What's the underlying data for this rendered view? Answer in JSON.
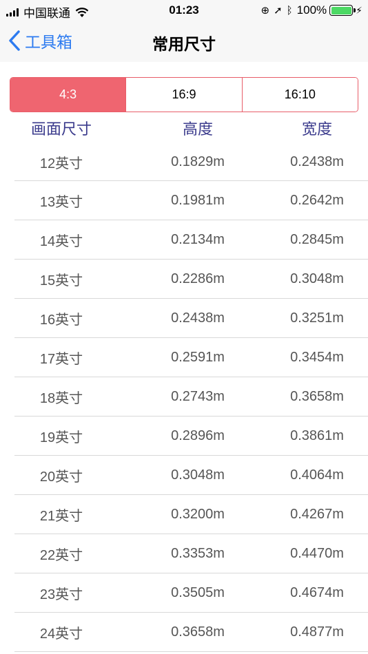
{
  "status": {
    "carrier": "中国联通",
    "time": "01:23",
    "battery_pct": "100%"
  },
  "nav": {
    "back_label": "工具箱",
    "title": "常用尺寸"
  },
  "tabs": [
    {
      "label": "4:3",
      "active": true
    },
    {
      "label": "16:9",
      "active": false
    },
    {
      "label": "16:10",
      "active": false
    }
  ],
  "columns": {
    "size": "画面尺寸",
    "height": "高度",
    "width": "宽度"
  },
  "rows": [
    {
      "size": "12英寸",
      "height": "0.1829m",
      "width": "0.2438m"
    },
    {
      "size": "13英寸",
      "height": "0.1981m",
      "width": "0.2642m"
    },
    {
      "size": "14英寸",
      "height": "0.2134m",
      "width": "0.2845m"
    },
    {
      "size": "15英寸",
      "height": "0.2286m",
      "width": "0.3048m"
    },
    {
      "size": "16英寸",
      "height": "0.2438m",
      "width": "0.3251m"
    },
    {
      "size": "17英寸",
      "height": "0.2591m",
      "width": "0.3454m"
    },
    {
      "size": "18英寸",
      "height": "0.2743m",
      "width": "0.3658m"
    },
    {
      "size": "19英寸",
      "height": "0.2896m",
      "width": "0.3861m"
    },
    {
      "size": "20英寸",
      "height": "0.3048m",
      "width": "0.4064m"
    },
    {
      "size": "21英寸",
      "height": "0.3200m",
      "width": "0.4267m"
    },
    {
      "size": "22英寸",
      "height": "0.3353m",
      "width": "0.4470m"
    },
    {
      "size": "23英寸",
      "height": "0.3505m",
      "width": "0.4674m"
    },
    {
      "size": "24英寸",
      "height": "0.3658m",
      "width": "0.4877m"
    }
  ],
  "colors": {
    "accent": "#ef6570",
    "link": "#2d7bf0",
    "header_text": "#3a3a8c"
  }
}
